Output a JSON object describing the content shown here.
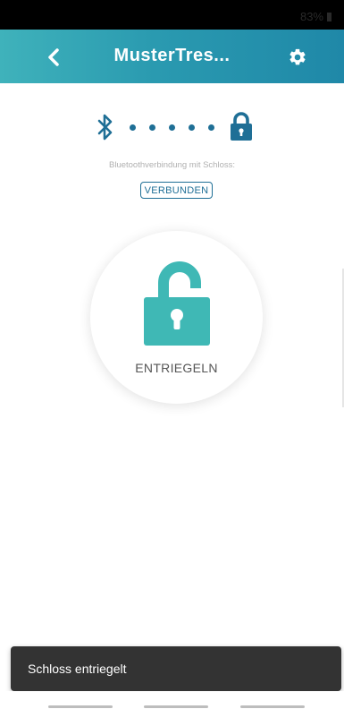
{
  "status_bar": {
    "battery_text": "83%"
  },
  "app_bar": {
    "title": "MusterTres...",
    "back_icon": "chevron-left-icon",
    "settings_icon": "gear-icon"
  },
  "connection": {
    "bluetooth_icon": "bluetooth-icon",
    "lock_icon": "lock-icon",
    "label": "Bluetoothverbindung mit Schloss:",
    "status": "VERBUNDEN"
  },
  "unlock": {
    "label": "ENTRIEGELN",
    "icon": "unlocked-padlock-icon"
  },
  "snackbar": {
    "message": "Schloss entriegelt"
  },
  "colors": {
    "accent": "#3fb2bb",
    "primary_dark": "#1f6f96",
    "padlock": "#3fb8b5",
    "snackbar": "#333333"
  }
}
